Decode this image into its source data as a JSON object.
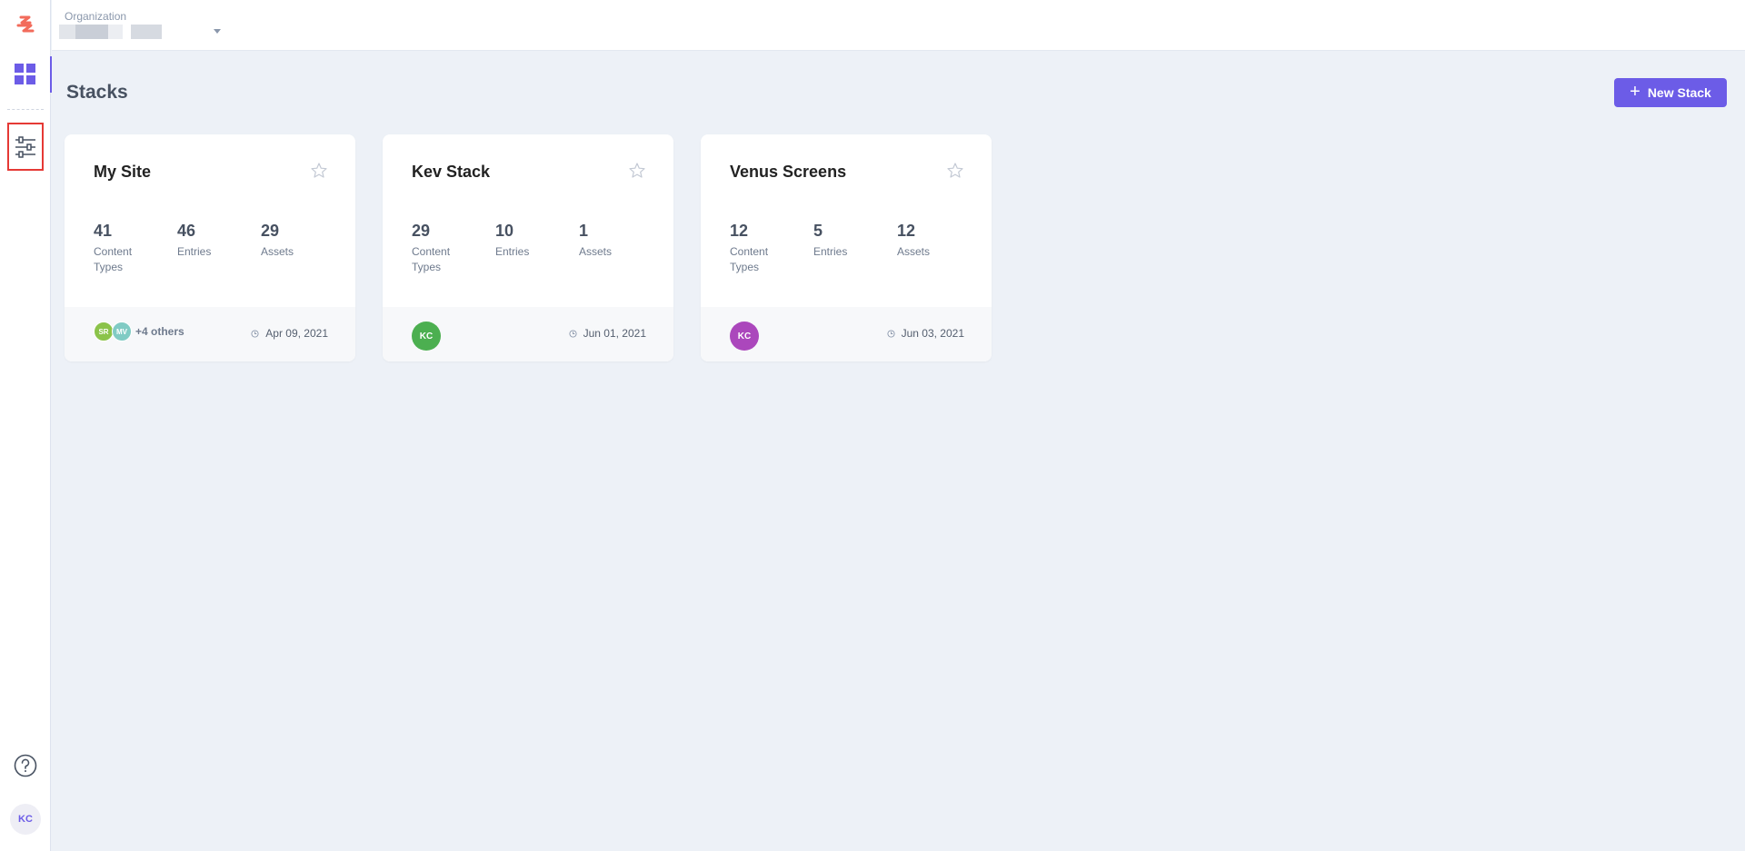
{
  "header": {
    "org_label": "Organization"
  },
  "sidebar": {
    "icons": [
      "contentstack-logo-icon",
      "dashboard-icon",
      "settings-sliders-icon",
      "help-icon"
    ],
    "user_initials": "KC"
  },
  "main": {
    "title": "Stacks",
    "new_stack_label": "New Stack"
  },
  "stacks": [
    {
      "name": "My Site",
      "stats": [
        {
          "value": "41",
          "label": "Content Types"
        },
        {
          "value": "46",
          "label": "Entries"
        },
        {
          "value": "29",
          "label": "Assets"
        }
      ],
      "avatars": [
        {
          "initials": "SR",
          "color": "#8bc34a"
        },
        {
          "initials": "MV",
          "color": "#80cbc4"
        }
      ],
      "others": "+4 others",
      "date": "Apr 09, 2021"
    },
    {
      "name": "Kev Stack",
      "stats": [
        {
          "value": "29",
          "label": "Content Types"
        },
        {
          "value": "10",
          "label": "Entries"
        },
        {
          "value": "1",
          "label": "Assets"
        }
      ],
      "avatars": [
        {
          "initials": "KC",
          "color": "#4caf50"
        }
      ],
      "others": "",
      "date": "Jun 01, 2021"
    },
    {
      "name": "Venus Screens",
      "stats": [
        {
          "value": "12",
          "label": "Content Types"
        },
        {
          "value": "5",
          "label": "Entries"
        },
        {
          "value": "12",
          "label": "Assets"
        }
      ],
      "avatars": [
        {
          "initials": "KC",
          "color": "#ab47bc"
        }
      ],
      "others": "",
      "date": "Jun 03, 2021"
    }
  ],
  "colors": {
    "accent": "#6c5ce7",
    "background": "#edf1f7",
    "highlight_box": "#e53935"
  }
}
